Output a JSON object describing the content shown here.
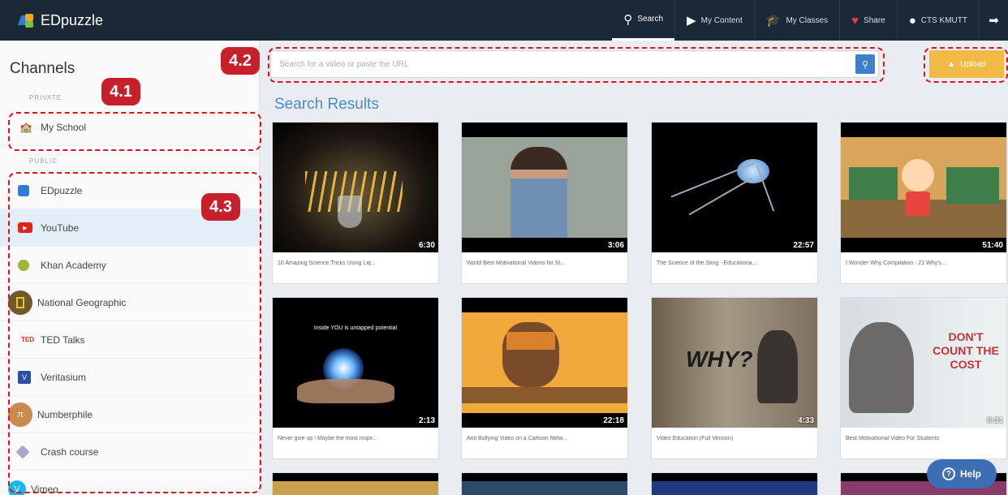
{
  "header": {
    "logo_text": "EDpuzzle",
    "nav": [
      {
        "label": "Search",
        "icon": "search-icon",
        "active": true
      },
      {
        "label": "My Content",
        "icon": "play-icon"
      },
      {
        "label": "My Classes",
        "icon": "graduation-cap-icon"
      },
      {
        "label": "Share",
        "icon": "heart-icon"
      },
      {
        "label": "CTS KMUTT",
        "icon": "user-icon"
      }
    ]
  },
  "sidebar": {
    "title": "Channels",
    "private_caption": "PRIVATE",
    "public_caption": "PUBLIC",
    "private_items": [
      {
        "label": "My School",
        "icon": "school-icon"
      }
    ],
    "public_items": [
      {
        "label": "EDpuzzle",
        "icon": "edpuzzle-icon"
      },
      {
        "label": "YouTube",
        "icon": "youtube-icon",
        "active": true
      },
      {
        "label": "Khan Academy",
        "icon": "khan-academy-icon"
      },
      {
        "label": "National Geographic",
        "icon": "national-geographic-icon"
      },
      {
        "label": "TED Talks",
        "icon": "ted-icon"
      },
      {
        "label": "Veritasium",
        "icon": "veritasium-icon"
      },
      {
        "label": "Numberphile",
        "icon": "numberphile-icon"
      },
      {
        "label": "Crash course",
        "icon": "crash-course-icon"
      },
      {
        "label": "Vimeo",
        "icon": "vimeo-icon"
      }
    ]
  },
  "search": {
    "placeholder": "Search for a video or paste the URL",
    "upload_label": "Upload"
  },
  "results_title": "Search Results",
  "videos": [
    {
      "title": "10 Amazing Science Tricks Using Liq...",
      "duration": "6:30"
    },
    {
      "title": "World Best Motivational Videos for St...",
      "duration": "3:06"
    },
    {
      "title": "The Science of the Sting - Educationa...",
      "duration": "22:57"
    },
    {
      "title": "I Wonder Why Compilation - 21 Why's...",
      "duration": "51:40"
    },
    {
      "title": "Never give up ! Maybe the most inspir...",
      "duration": "2:13",
      "overlay": "Inside YOU is untapped potential"
    },
    {
      "title": "Anti Bullying Video on a Cartoon Netw...",
      "duration": "22:18"
    },
    {
      "title": "Video Education (Full Version)",
      "duration": "4:33",
      "overlay": "WHY?"
    },
    {
      "title": "Best Motivational Video For Students",
      "duration": "6:31",
      "overlay": "DON'T COUNT THE COST"
    }
  ],
  "annotations": [
    "4.1",
    "4.2",
    "4.3"
  ],
  "help_label": "Help"
}
